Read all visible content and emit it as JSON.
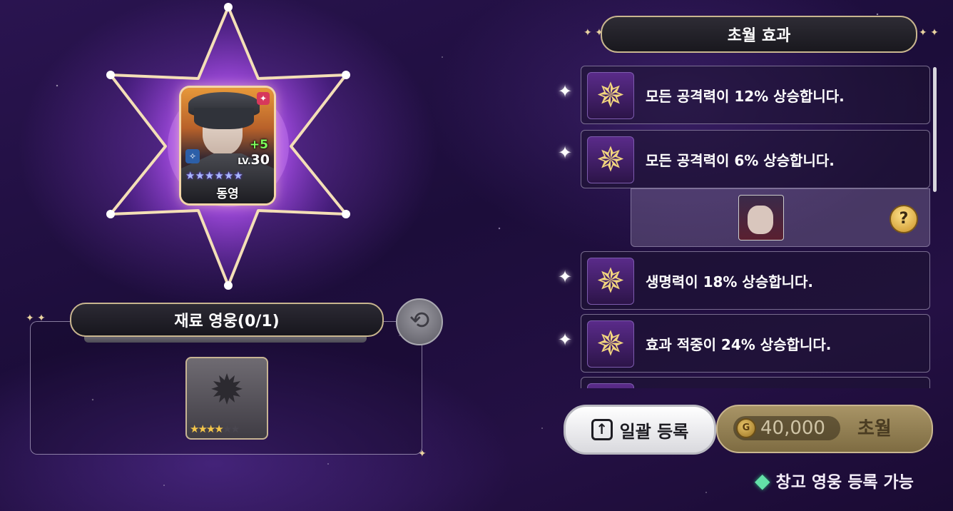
{
  "hero": {
    "level_prefix": "LV.",
    "level": "30",
    "plus": "+5",
    "name": "동영",
    "stars": 6,
    "class_icon": "mage-class-icon",
    "corner_icon": "role-icon"
  },
  "material": {
    "header": "재료 영웅(0/1)",
    "slot_stars_total": 6,
    "slot_stars_filled": 4,
    "reset_icon": "reset-icon"
  },
  "effects": {
    "title": "초월 효과",
    "items": [
      {
        "text": "모든 공격력이 12% 상승합니다.",
        "icon": "star-emblem-icon"
      },
      {
        "text": "모든 공격력이 6% 상승합니다.",
        "icon": "star-emblem-icon"
      },
      {
        "text": "생명력이 18% 상승합니다.",
        "icon": "star-emblem-icon"
      },
      {
        "text": "효과 적중이 24% 상승합니다.",
        "icon": "star-emblem-icon"
      }
    ],
    "help_label": "?"
  },
  "buttons": {
    "bulk_label": "일괄 등록",
    "cost": "40,000",
    "transcend_label": "초월"
  },
  "footer": {
    "storage_note": "창고 영웅 등록 가능"
  }
}
